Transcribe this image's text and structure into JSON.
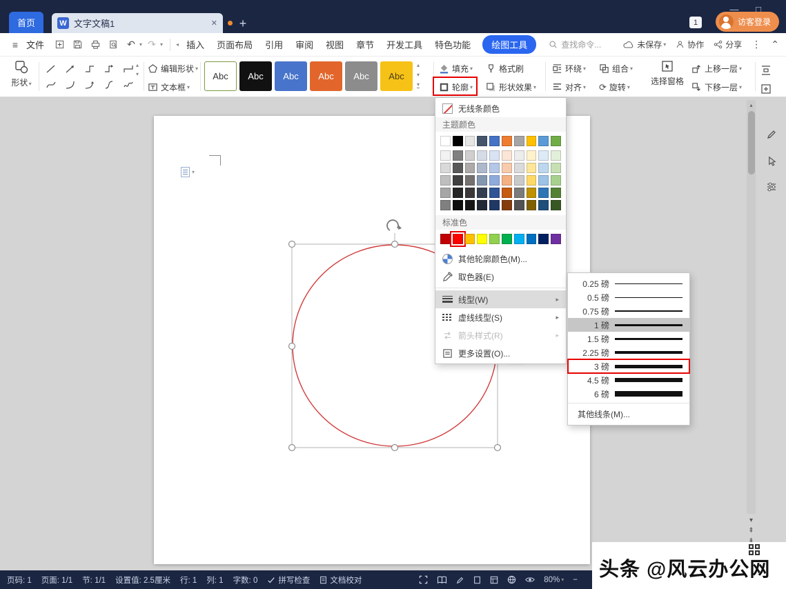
{
  "titlebar": {
    "home": "首页",
    "doc_icon": "W",
    "doc_tab": "文字文稿1",
    "badge": "1",
    "login": "访客登录"
  },
  "menubar": {
    "file": "文件",
    "tabs": [
      {
        "label": "插入"
      },
      {
        "label": "页面布局"
      },
      {
        "label": "引用"
      },
      {
        "label": "审阅"
      },
      {
        "label": "视图"
      },
      {
        "label": "章节"
      },
      {
        "label": "开发工具"
      },
      {
        "label": "特色功能"
      }
    ],
    "active_tool_tab": "绘图工具",
    "search": "查找命令...",
    "unsaved": "未保存",
    "collab": "协作",
    "share": "分享"
  },
  "ribbon": {
    "shapes": "形状",
    "edit_shape": "编辑形状",
    "text_box": "文本框",
    "style_tiles": [
      {
        "label": "Abc",
        "bg": "#ffffff",
        "fg": "#333333",
        "border": "#7a9a3e"
      },
      {
        "label": "Abc",
        "bg": "#111111",
        "fg": "#ffffff",
        "border": "#111111"
      },
      {
        "label": "Abc",
        "bg": "#4874cb",
        "fg": "#ffffff",
        "border": "#4874cb"
      },
      {
        "label": "Abc",
        "bg": "#e2662c",
        "fg": "#ffffff",
        "border": "#e2662c"
      },
      {
        "label": "Abc",
        "bg": "#8c8c8c",
        "fg": "#ffffff",
        "border": "#8c8c8c"
      },
      {
        "label": "Abc",
        "bg": "#f7c217",
        "fg": "#4a3d10",
        "border": "#f7c217"
      }
    ],
    "fill": "填充",
    "format_painter": "格式刷",
    "outline": "轮廓",
    "shape_effects": "形状效果",
    "wrap": "环绕",
    "align": "对齐",
    "group": "组合",
    "rotate": "旋转",
    "select_pane": "选择窗格",
    "bring_forward": "上移一层",
    "send_backward": "下移一层"
  },
  "outline_menu": {
    "no_line": "无线条颜色",
    "theme_label": "主题颜色",
    "theme_rows": [
      [
        "#ffffff",
        "#000000",
        "#e7e6e6",
        "#44546a",
        "#4472c4",
        "#ed7d31",
        "#a5a5a5",
        "#ffc000",
        "#5b9bd5",
        "#70ad47"
      ],
      [
        "#f2f2f2",
        "#808080",
        "#d0cece",
        "#d6dce5",
        "#dae3f3",
        "#fbe5d6",
        "#ededed",
        "#fff2cc",
        "#deebf7",
        "#e2efda"
      ],
      [
        "#d9d9d9",
        "#595959",
        "#aeaaaa",
        "#adb9ca",
        "#b4c7e7",
        "#f8cbad",
        "#dbdbdb",
        "#ffe699",
        "#bdd7ee",
        "#c6e0b4"
      ],
      [
        "#bfbfbf",
        "#404040",
        "#757171",
        "#8497b0",
        "#8faadc",
        "#f4b183",
        "#c9c9c9",
        "#ffd966",
        "#9dc3e6",
        "#a9d18e"
      ],
      [
        "#a6a6a6",
        "#262626",
        "#3a3838",
        "#333f50",
        "#2f5597",
        "#c55a11",
        "#7b7b7b",
        "#bf9000",
        "#2e75b6",
        "#548235"
      ],
      [
        "#808080",
        "#0d0d0d",
        "#161616",
        "#222a35",
        "#203864",
        "#843c0c",
        "#525252",
        "#7f6000",
        "#1f4e79",
        "#385723"
      ]
    ],
    "standard_label": "标准色",
    "standard_colors": [
      "#c00000",
      "#ff0000",
      "#ffc000",
      "#ffff00",
      "#92d050",
      "#00b050",
      "#00b0f0",
      "#0070c0",
      "#002060",
      "#7030a0"
    ],
    "more_colors": "其他轮廓颜色(M)...",
    "eyedropper": "取色器(E)",
    "line_style": "线型(W)",
    "dash_style": "虚线线型(S)",
    "arrow_style": "箭头样式(R)",
    "more_settings": "更多设置(O)..."
  },
  "weight_menu": {
    "items": [
      {
        "label": "0.25 磅",
        "px": 1,
        "state": "normal"
      },
      {
        "label": "0.5 磅",
        "px": 1,
        "state": "normal"
      },
      {
        "label": "0.75 磅",
        "px": 2,
        "state": "normal"
      },
      {
        "label": "1 磅",
        "px": 3,
        "state": "selected"
      },
      {
        "label": "1.5 磅",
        "px": 3,
        "state": "normal"
      },
      {
        "label": "2.25 磅",
        "px": 4,
        "state": "normal"
      },
      {
        "label": "3 磅",
        "px": 5,
        "state": "target"
      },
      {
        "label": "4.5 磅",
        "px": 6,
        "state": "normal"
      },
      {
        "label": "6 磅",
        "px": 8,
        "state": "normal"
      }
    ],
    "more": "其他线条(M)..."
  },
  "statusbar": {
    "left_items": [
      "页码: 1",
      "页面: 1/1",
      "节: 1/1",
      "设置值: 2.5厘米",
      "行: 1",
      "列: 1",
      "字数: 0"
    ],
    "spell": "拼写检查",
    "proof": "文档校对",
    "zoom": "80%"
  },
  "watermark": "头条 @风云办公网",
  "icons": {
    "caret_down": "▾",
    "caret_up": "▴",
    "chevron_right": "▸",
    "chevron_left": "◂",
    "close": "✕",
    "plus": "+",
    "minimize": "—",
    "maximize": "□",
    "ellipsis": "⋮",
    "collapse": "⌃",
    "undo": "↶",
    "redo": "↷",
    "hamburger": "≡",
    "rotate": "⟳",
    "page_up": "⇞",
    "page_down": "⇟",
    "minus": "−",
    "check": "✓"
  },
  "colors": {
    "accent_blue": "#2a66f0",
    "titlebar_bg": "#1b2642",
    "annotation_red": "#e60000",
    "shape_stroke_red": "#d23b3b"
  }
}
